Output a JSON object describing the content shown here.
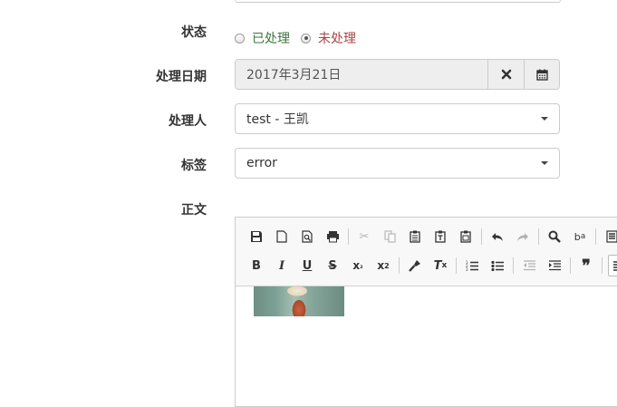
{
  "form": {
    "status": {
      "label": "状态",
      "options": [
        {
          "label": "已处理",
          "checked": false,
          "color": "#3c763d"
        },
        {
          "label": "未处理",
          "checked": true,
          "color": "#a94442"
        }
      ]
    },
    "date": {
      "label": "处理日期",
      "value": "2017年3月21日"
    },
    "handler": {
      "label": "处理人",
      "value": "test - 王凯"
    },
    "tag": {
      "label": "标签",
      "value": "error"
    },
    "body": {
      "label": "正文"
    }
  },
  "editor": {
    "toolbar_row1": [
      {
        "icon": "save-icon",
        "glyph": "💾"
      },
      {
        "icon": "new-document-icon",
        "glyph": "🗋"
      },
      {
        "icon": "preview-icon",
        "glyph": "🔍"
      },
      {
        "icon": "print-icon",
        "glyph": "🖶"
      },
      {
        "icon": "cut-icon",
        "glyph": "✂"
      },
      {
        "icon": "copy-icon",
        "glyph": "⧉"
      },
      {
        "icon": "paste-icon",
        "glyph": "📋"
      },
      {
        "icon": "paste-text-icon",
        "glyph": "📋"
      },
      {
        "icon": "paste-word-icon",
        "glyph": "📋"
      },
      {
        "icon": "undo-icon",
        "glyph": "↶"
      },
      {
        "icon": "redo-icon",
        "glyph": "↷"
      },
      {
        "icon": "find-icon",
        "glyph": "🔍"
      },
      {
        "icon": "replace-icon",
        "glyph": "ba"
      },
      {
        "icon": "template-icon",
        "glyph": "▦"
      }
    ],
    "toolbar_row2": [
      {
        "icon": "bold-icon",
        "glyph": "B"
      },
      {
        "icon": "italic-icon",
        "glyph": "I"
      },
      {
        "icon": "underline-icon",
        "glyph": "U"
      },
      {
        "icon": "strikethrough-icon",
        "glyph": "S"
      },
      {
        "icon": "subscript-icon",
        "glyph": "x₂"
      },
      {
        "icon": "superscript-icon",
        "glyph": "x²"
      },
      {
        "icon": "format-painter-icon",
        "glyph": "🖌"
      },
      {
        "icon": "clear-format-icon",
        "glyph": "Tx"
      },
      {
        "icon": "numbered-list-icon",
        "glyph": "≡"
      },
      {
        "icon": "bulleted-list-icon",
        "glyph": "≡"
      },
      {
        "icon": "outdent-icon",
        "glyph": "⇤"
      },
      {
        "icon": "indent-icon",
        "glyph": "⇥"
      },
      {
        "icon": "blockquote-icon",
        "glyph": "❞"
      },
      {
        "icon": "align-left-icon",
        "glyph": "≡"
      }
    ]
  },
  "colors": {
    "border": "#cccccc",
    "addon_bg": "#eeeeee",
    "toolbar_bg": "#f8f8f8"
  }
}
